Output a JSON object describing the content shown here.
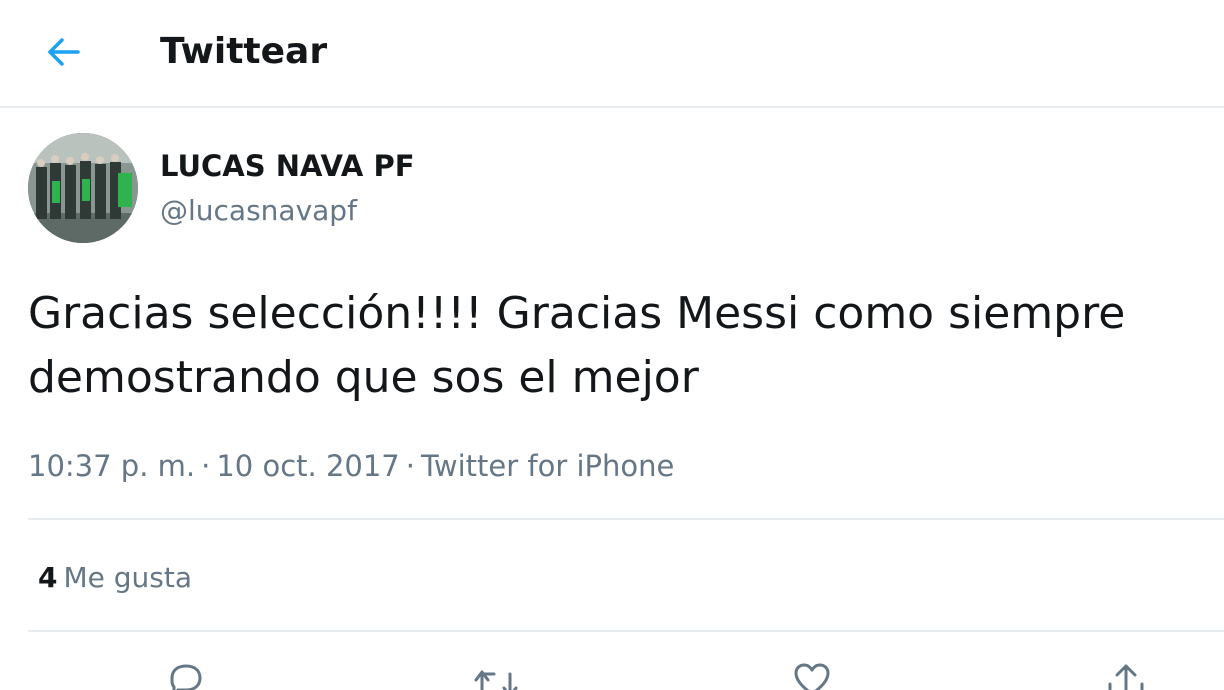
{
  "header": {
    "title": "Twittear",
    "back_icon": "arrow-left-icon"
  },
  "tweet": {
    "author": {
      "display_name": "LUCAS NAVA PF",
      "handle": "@lucasnavapf"
    },
    "text": "Gracias selección!!!! Gracias Messi como siempre demostrando que sos el mejor",
    "time": "10:37 p. m.",
    "separator": "·",
    "date": "10 oct. 2017",
    "source": "Twitter for iPhone"
  },
  "stats": {
    "likes_count": "4",
    "likes_label": "Me gusta"
  },
  "actions": [
    "reply-icon",
    "retweet-icon",
    "like-icon",
    "share-icon"
  ],
  "colors": {
    "accent": "#1da1f2",
    "text": "#14171a",
    "secondary": "#657786",
    "divider": "#e6ecf0"
  }
}
